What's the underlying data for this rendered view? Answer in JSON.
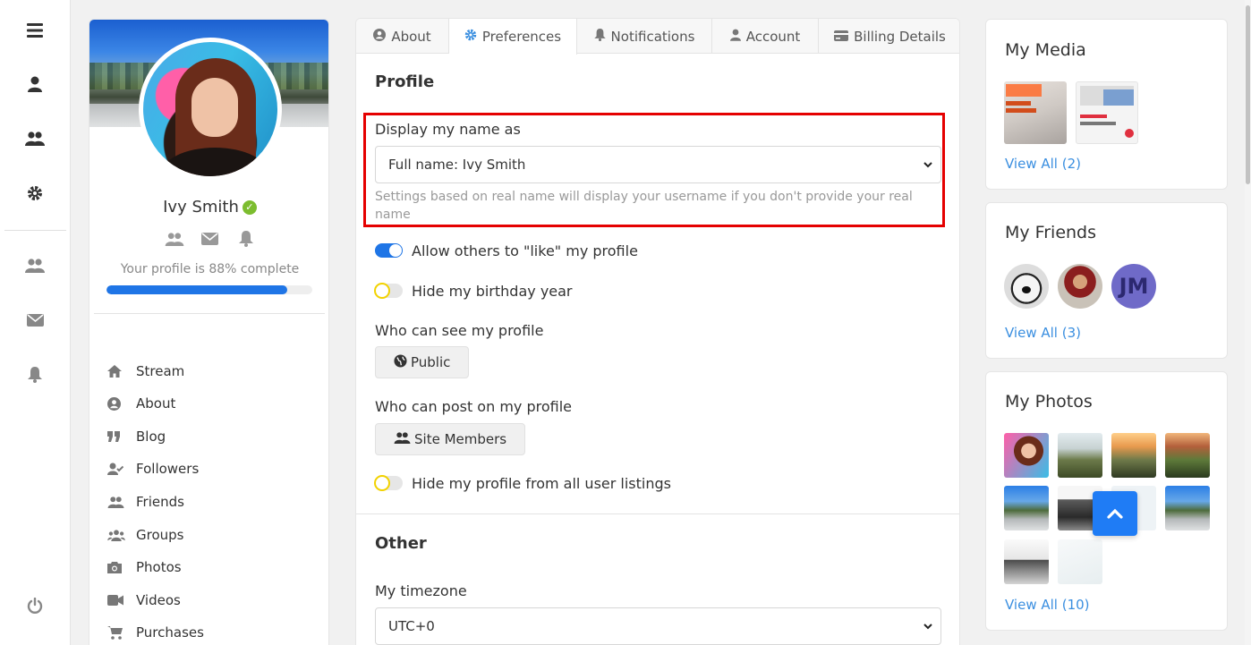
{
  "rail": {
    "icons": [
      "menu-icon",
      "user-icon",
      "users-icon",
      "gear-icon",
      "friends-icon",
      "envelope-icon",
      "bell-icon",
      "power-icon"
    ]
  },
  "profile": {
    "name": "Ivy Smith",
    "completion_text": "Your profile is 88% complete",
    "completion_percent": 88,
    "nav": [
      {
        "label": "Stream",
        "icon": "home-icon"
      },
      {
        "label": "About",
        "icon": "user-circle-icon"
      },
      {
        "label": "Blog",
        "icon": "quote-icon"
      },
      {
        "label": "Followers",
        "icon": "user-check-icon"
      },
      {
        "label": "Friends",
        "icon": "users-icon"
      },
      {
        "label": "Groups",
        "icon": "groups-icon"
      },
      {
        "label": "Photos",
        "icon": "camera-icon"
      },
      {
        "label": "Videos",
        "icon": "video-icon"
      },
      {
        "label": "Purchases",
        "icon": "cart-icon"
      }
    ]
  },
  "tabs": [
    {
      "label": "About",
      "icon": "user-circle-icon"
    },
    {
      "label": "Preferences",
      "icon": "gear-icon",
      "active": true
    },
    {
      "label": "Notifications",
      "icon": "bell-icon"
    },
    {
      "label": "Account",
      "icon": "user-icon"
    },
    {
      "label": "Billing Details",
      "icon": "credit-card-icon"
    }
  ],
  "preferences": {
    "profile_title": "Profile",
    "display_name_label": "Display my name as",
    "display_name_value": "Full name: Ivy Smith",
    "display_name_help": "Settings based on real name will display your username if you don't provide your real name",
    "allow_like_label": "Allow others to \"like\" my profile",
    "allow_like_on": true,
    "hide_birthday_label": "Hide my birthday year",
    "hide_birthday_on": false,
    "who_see_label": "Who can see my profile",
    "who_see_value": "Public",
    "who_post_label": "Who can post on my profile",
    "who_post_value": "Site Members",
    "hide_listing_label": "Hide my profile from all user listings",
    "hide_listing_on": false,
    "other_title": "Other",
    "timezone_label": "My timezone",
    "timezone_value": "UTC+0"
  },
  "widgets": {
    "media": {
      "title": "My Media",
      "view_all": "View All (2)"
    },
    "friends": {
      "title": "My Friends",
      "view_all": "View All (3)",
      "initials": "JM"
    },
    "photos": {
      "title": "My Photos",
      "view_all": "View All (10)"
    }
  },
  "colors": {
    "accent": "#1f75e6",
    "link": "#3b8fe0",
    "highlight": "#e50000",
    "verified": "#7cbd2f",
    "friend_initials_bg": "#6f6ac8"
  }
}
